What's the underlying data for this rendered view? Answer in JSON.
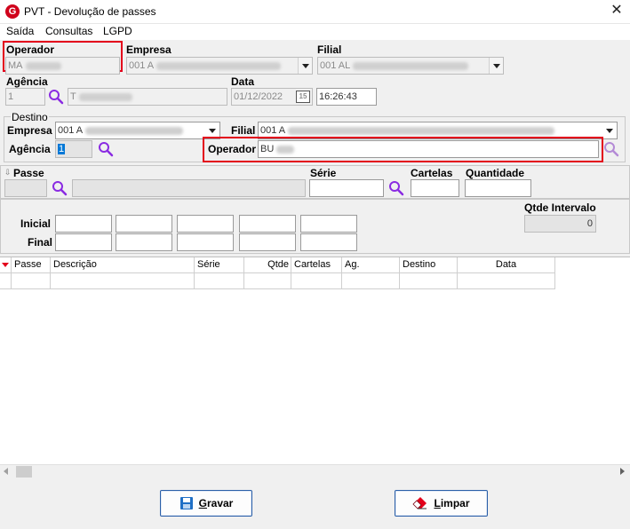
{
  "window": {
    "title": "PVT - Devolução de passes",
    "app_icon_letter": "G"
  },
  "menu": {
    "items": [
      "Saída",
      "Consultas",
      "LGPD"
    ]
  },
  "header": {
    "operador_label": "Operador",
    "operador_value": "MA",
    "empresa_label": "Empresa",
    "empresa_value": "001 A",
    "filial_label": "Filial",
    "filial_value": "001 AL",
    "agencia_label": "Agência",
    "agencia_value": "1",
    "agencia_name_value": "T",
    "data_label": "Data",
    "data_value": "01/12/2022",
    "hora_value": "16:26:43",
    "calendar_day": "15"
  },
  "destino": {
    "group_label": "Destino",
    "empresa_label": "Empresa",
    "empresa_value": "001 A",
    "filial_label": "Filial",
    "filial_value": "001 A",
    "agencia_label": "Agência",
    "agencia_value": "1",
    "operador_label": "Operador",
    "operador_value": "BU"
  },
  "passe": {
    "passe_label": "Passe",
    "serie_label": "Série",
    "cartelas_label": "Cartelas",
    "quantidade_label": "Quantidade"
  },
  "intervalo": {
    "inicial_label": "Inicial",
    "final_label": "Final",
    "qtde_intervalo_label": "Qtde Intervalo",
    "qtde_intervalo_value": "0"
  },
  "grid": {
    "columns": [
      "Passe",
      "Descrição",
      "Série",
      "Qtde",
      "Cartelas",
      "Ag.",
      "Destino",
      "Data"
    ]
  },
  "buttons": {
    "gravar_first": "G",
    "gravar_rest": "ravar",
    "limpar_first": "L",
    "limpar_rest": "impar"
  }
}
